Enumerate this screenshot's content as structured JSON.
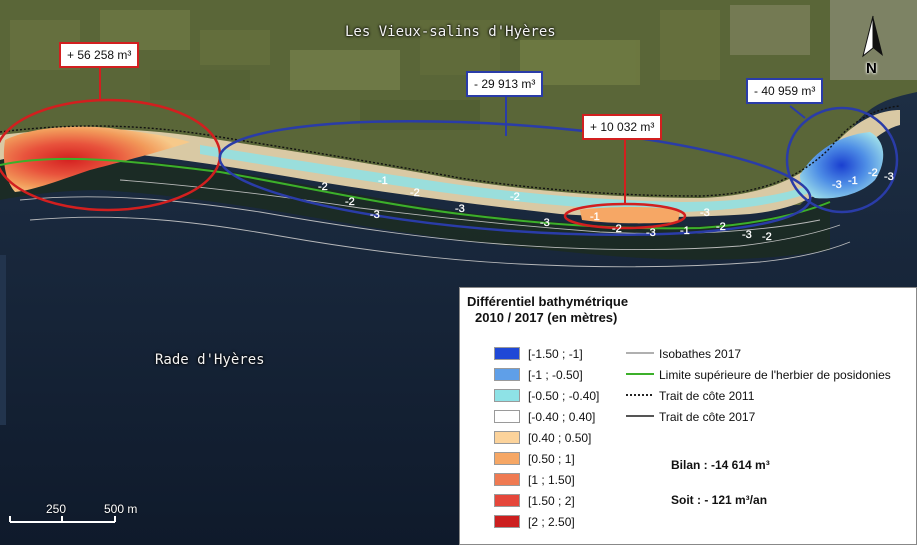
{
  "map": {
    "place_labels": [
      "Les Vieux-salins d'Hyères",
      "Rade d'Hyères"
    ],
    "north_arrow": "N",
    "isobath_labels": [
      "-2",
      "-1",
      "-2",
      "-3",
      "-2",
      "-3",
      "-2",
      "-3",
      "-1",
      "-2",
      "-3",
      "-1",
      "-2",
      "-3",
      "-2",
      "-3",
      "-3",
      "-1",
      "-2",
      "-3"
    ]
  },
  "annotations": [
    {
      "text": "+ 56 258 m³",
      "color": "#d21f1f"
    },
    {
      "text": "- 29 913 m³",
      "color": "#2a3ca8"
    },
    {
      "text": "+ 10 032 m³",
      "color": "#d21f1f"
    },
    {
      "text": "- 40 959 m³",
      "color": "#2a3ca8"
    }
  ],
  "scale_bar": {
    "labels": [
      "250",
      "500 m"
    ]
  },
  "legend": {
    "title_line1": "Différentiel bathymétrique",
    "title_line2": "2010 / 2017 (en mètres)",
    "classes": [
      {
        "label": "[-1.50 ; -1]",
        "color": "#1f48d6"
      },
      {
        "label": "[-1 ; -0.50]",
        "color": "#5f9fe8"
      },
      {
        "label": "[-0.50 ; -0.40]",
        "color": "#8ee2e6"
      },
      {
        "label": "[-0.40 ; 0.40]",
        "color": "#ffffff"
      },
      {
        "label": "[0.40 ; 0.50]",
        "color": "#fcd39b"
      },
      {
        "label": "[0.50 ; 1]",
        "color": "#f6a765"
      },
      {
        "label": "[1 ; 1.50]",
        "color": "#ef7a52"
      },
      {
        "label": "[1.50 ; 2]",
        "color": "#e5473b"
      },
      {
        "label": "[2 ; 2.50]",
        "color": "#cc1f1f"
      }
    ],
    "lines": [
      {
        "label": "Isobathes 2017",
        "color": "#b0b0b0",
        "style": "solid"
      },
      {
        "label": "Limite supérieure de l'herbier de posidonies",
        "color": "#3cb02a",
        "style": "solid"
      },
      {
        "label": "Trait de côte 2011",
        "color": "#222222",
        "style": "dotted"
      },
      {
        "label": "Trait de côte 2017",
        "color": "#555555",
        "style": "solid"
      }
    ],
    "bilan": "Bilan : -14 614 m³",
    "soit": "Soit : - 121 m³/an"
  }
}
